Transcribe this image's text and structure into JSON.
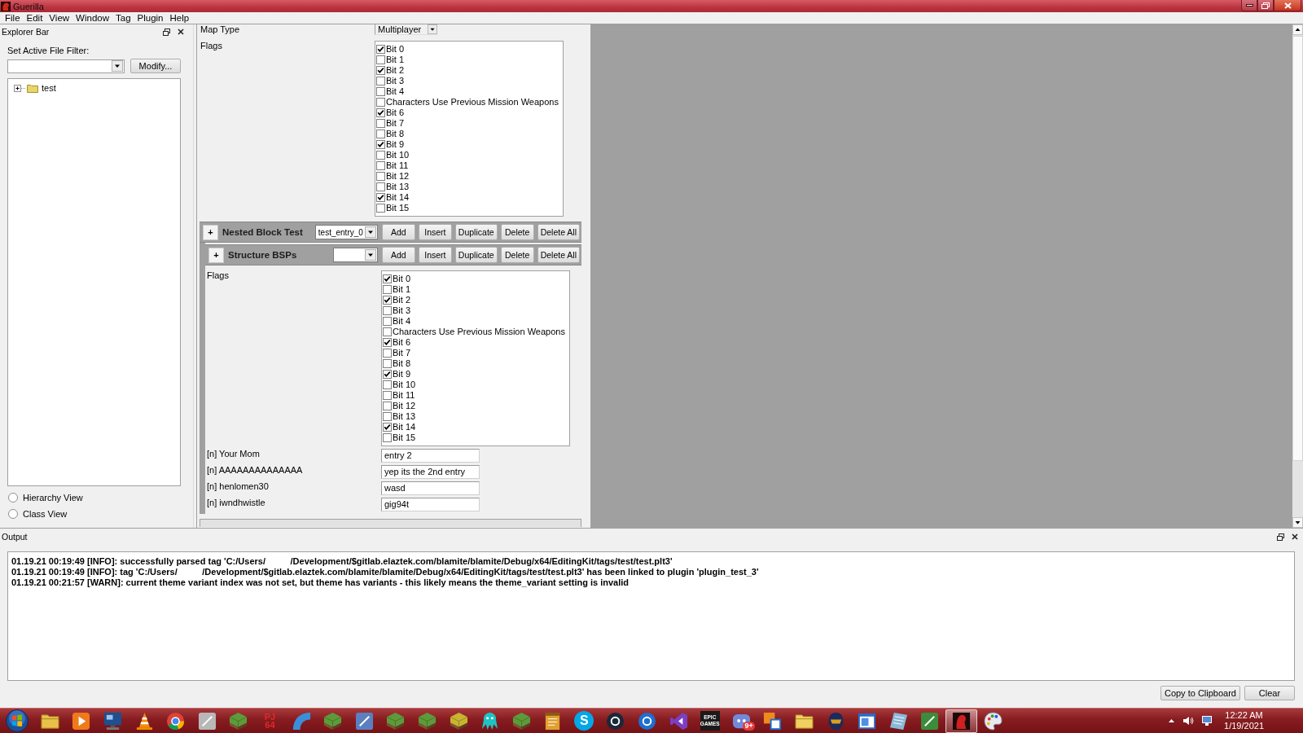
{
  "window": {
    "title": "Guerilla"
  },
  "menu": [
    "File",
    "Edit",
    "View",
    "Window",
    "Tag",
    "Plugin",
    "Help"
  ],
  "explorer_bar": {
    "title": "Explorer Bar",
    "filter_label": "Set Active File Filter:",
    "modify_button": "Modify...",
    "tree": [
      {
        "label": "test",
        "expanded": false
      }
    ],
    "views": [
      {
        "label": "Hierarchy View",
        "selected": false
      },
      {
        "label": "Class View",
        "selected": false
      }
    ]
  },
  "editor": {
    "map_type": {
      "label": "Map Type",
      "value": "Multiplayer"
    },
    "flags": {
      "label": "Flags",
      "options": [
        {
          "label": "Bit 0",
          "checked": true
        },
        {
          "label": "Bit 1",
          "checked": false
        },
        {
          "label": "Bit 2",
          "checked": true
        },
        {
          "label": "Bit 3",
          "checked": false
        },
        {
          "label": "Bit 4",
          "checked": false
        },
        {
          "label": "Characters Use Previous Mission Weapons",
          "checked": false
        },
        {
          "label": "Bit 6",
          "checked": true
        },
        {
          "label": "Bit 7",
          "checked": false
        },
        {
          "label": "Bit 8",
          "checked": false
        },
        {
          "label": "Bit 9",
          "checked": true
        },
        {
          "label": "Bit 10",
          "checked": false
        },
        {
          "label": "Bit 11",
          "checked": false
        },
        {
          "label": "Bit 12",
          "checked": false
        },
        {
          "label": "Bit 13",
          "checked": false
        },
        {
          "label": "Bit 14",
          "checked": true
        },
        {
          "label": "Bit 15",
          "checked": false
        }
      ]
    },
    "blocks": [
      {
        "toggle": "+",
        "title": "Nested Block Test",
        "entry": "test_entry_0",
        "buttons": [
          "Add",
          "Insert",
          "Duplicate",
          "Delete",
          "Delete All"
        ],
        "children": [
          {
            "toggle": "+",
            "title": "Structure BSPs",
            "buttons": [
              "Add",
              "Insert",
              "Duplicate",
              "Delete",
              "Delete All"
            ],
            "fields": [
              {
                "kind": "flags",
                "label": "Flags",
                "options": [
                  {
                    "label": "Bit 0",
                    "checked": true
                  },
                  {
                    "label": "Bit 1",
                    "checked": false
                  },
                  {
                    "label": "Bit 2",
                    "checked": true
                  },
                  {
                    "label": "Bit 3",
                    "checked": false
                  },
                  {
                    "label": "Bit 4",
                    "checked": false
                  },
                  {
                    "label": "Characters Use Previous Mission Weapons",
                    "checked": false
                  },
                  {
                    "label": "Bit 6",
                    "checked": true
                  },
                  {
                    "label": "Bit 7",
                    "checked": false
                  },
                  {
                    "label": "Bit 8",
                    "checked": false
                  },
                  {
                    "label": "Bit 9",
                    "checked": true
                  },
                  {
                    "label": "Bit 10",
                    "checked": false
                  },
                  {
                    "label": "Bit 11",
                    "checked": false
                  },
                  {
                    "label": "Bit 12",
                    "checked": false
                  },
                  {
                    "label": "Bit 13",
                    "checked": false
                  },
                  {
                    "label": "Bit 14",
                    "checked": true
                  },
                  {
                    "label": "Bit 15",
                    "checked": false
                  }
                ]
              },
              {
                "kind": "text",
                "label": "[n] Your Mom",
                "value": "entry 2"
              },
              {
                "kind": "text",
                "label": "[n] AAAAAAAAAAAAAA",
                "value": "yep its the 2nd entry"
              },
              {
                "kind": "text",
                "label": "[n] henlomen30",
                "value": "wasd"
              },
              {
                "kind": "text",
                "label": "[n] iwndhwistle",
                "value": "gig94t"
              }
            ]
          }
        ]
      }
    ],
    "partial_block": true
  },
  "output": {
    "title": "Output",
    "lines": [
      "01.19.21 00:19:49 [INFO]: successfully parsed tag 'C:/Users/          /Development/$gitlab.elaztek.com/blamite/blamite/Debug/x64/EditingKit/tags/test/test.plt3'",
      "01.19.21 00:19:49 [INFO]: tag 'C:/Users/          /Development/$gitlab.elaztek.com/blamite/blamite/Debug/x64/EditingKit/tags/test/test.plt3' has been linked to plugin 'plugin_test_3'",
      "01.19.21 00:21:57 [WARN]: current theme variant index was not set, but theme has variants - this likely means the theme_variant setting is invalid"
    ],
    "buttons": [
      "Copy to Clipboard",
      "Clear"
    ]
  },
  "taskbar": {
    "apps": [
      {
        "kind": "folder",
        "color": "#e8c04a",
        "selected": false
      },
      {
        "kind": "play",
        "color": "#f07a1a",
        "selected": false
      },
      {
        "kind": "monitor",
        "color": "#1d4f91",
        "selected": false
      },
      {
        "kind": "cone",
        "color": "#f28c00",
        "selected": false
      },
      {
        "kind": "ring",
        "color": "#db4437",
        "selected": false
      },
      {
        "kind": "tile",
        "color": "#b8b8b8",
        "selected": false
      },
      {
        "kind": "cube",
        "color": "#5d9b3a",
        "selected": false
      },
      {
        "kind": "wordmark",
        "text": "PJ 64",
        "color": "#e02828",
        "selected": false
      },
      {
        "kind": "swoosh",
        "color": "#3b8fd9",
        "selected": false
      },
      {
        "kind": "cube",
        "color": "#5d9b3a",
        "selected": false
      },
      {
        "kind": "tile",
        "color": "#5c7fc0",
        "selected": false
      },
      {
        "kind": "cube",
        "color": "#5d9b3a",
        "selected": false
      },
      {
        "kind": "cube",
        "color": "#5d9b3a",
        "selected": false
      },
      {
        "kind": "cube",
        "color": "#c9b431",
        "selected": false
      },
      {
        "kind": "blob",
        "color": "#1fc3c3",
        "selected": false
      },
      {
        "kind": "cube",
        "color": "#5d9b3a",
        "selected": false
      },
      {
        "kind": "note",
        "color": "#e0a030",
        "selected": false
      },
      {
        "kind": "disc",
        "text": "S",
        "color": "#00a8e8",
        "selected": false
      },
      {
        "kind": "disc",
        "color": "#1b2838",
        "selected": false
      },
      {
        "kind": "disc",
        "color": "#1e6fd0",
        "selected": false
      },
      {
        "kind": "ribbon",
        "color": "#7b3fc4",
        "selected": false
      },
      {
        "kind": "tile",
        "text": "EPIC GAMES",
        "color": "#1a1a1a",
        "selected": false
      },
      {
        "kind": "chat",
        "color": "#7289da",
        "badge": "9+",
        "selected": false
      },
      {
        "kind": "squares",
        "color": "#f08a1c",
        "selected": false
      },
      {
        "kind": "folder",
        "color": "#f0d060",
        "selected": false
      },
      {
        "kind": "helmet",
        "color": "#1c2a5c",
        "selected": false
      },
      {
        "kind": "window",
        "color": "#2a6ac8",
        "selected": false
      },
      {
        "kind": "paper",
        "color": "#8ab8d8",
        "selected": false
      },
      {
        "kind": "tile",
        "color": "#3c8c3c",
        "selected": false
      },
      {
        "kind": "portrait",
        "color": "#d02020",
        "selected": true
      },
      {
        "kind": "palette",
        "color": "#e8e8f0",
        "selected": false
      }
    ],
    "clock": {
      "time": "12:22 AM",
      "date": "1/19/2021"
    }
  }
}
